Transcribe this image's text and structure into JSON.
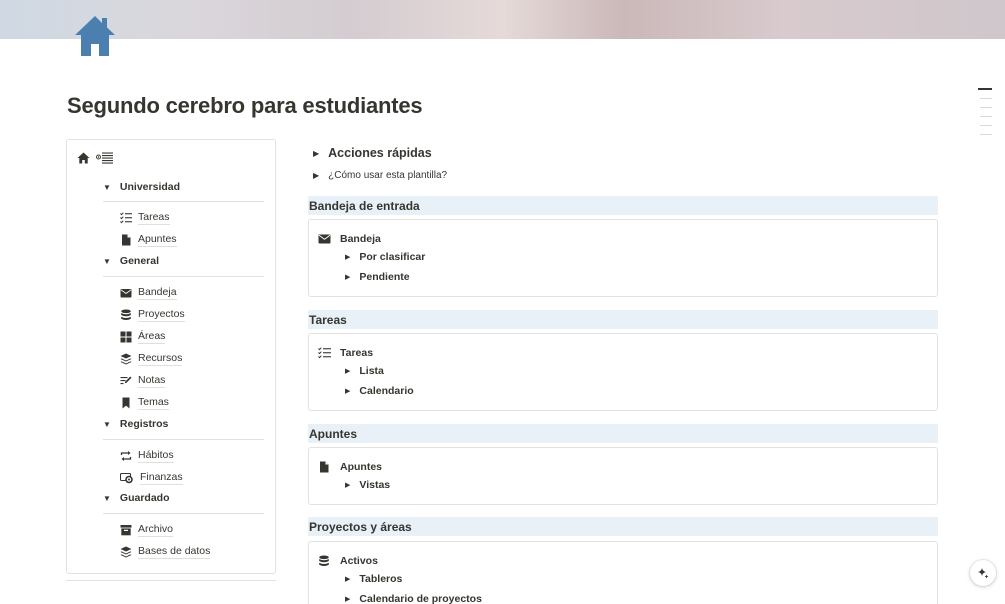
{
  "page": {
    "title": "Segundo cerebro para estudiantes",
    "icon": "house-icon",
    "cover_colors": [
      "#cfd9e3",
      "#d4ccd1",
      "#cbb8b9"
    ],
    "accent": "#4a7fb0"
  },
  "sidebar": {
    "groups": [
      {
        "label": "Universidad",
        "items": [
          {
            "label": "Tareas",
            "icon": "checklist-icon"
          },
          {
            "label": "Apuntes",
            "icon": "document-icon"
          }
        ]
      },
      {
        "label": "General",
        "items": [
          {
            "label": "Bandeja",
            "icon": "envelope-icon"
          },
          {
            "label": "Proyectos",
            "icon": "database-icon"
          },
          {
            "label": "Áreas",
            "icon": "grid-icon"
          },
          {
            "label": "Recursos",
            "icon": "layers-icon"
          },
          {
            "label": "Notas",
            "icon": "pencil-lines-icon"
          },
          {
            "label": "Temas",
            "icon": "bookmark-icon"
          }
        ]
      },
      {
        "label": "Registros",
        "items": [
          {
            "label": "Hábitos",
            "icon": "repeat-icon"
          },
          {
            "label": "Finanzas",
            "icon": "money-icon"
          }
        ]
      },
      {
        "label": "Guardado",
        "items": [
          {
            "label": "Archivo",
            "icon": "archive-icon"
          },
          {
            "label": "Bases de datos",
            "icon": "layers-icon"
          }
        ]
      }
    ]
  },
  "main": {
    "quick_actions": "Acciones rápidas",
    "how_to": "¿Cómo usar esta plantilla?",
    "sections": [
      {
        "heading": "Bandeja de entrada",
        "card_title": "Bandeja",
        "icon": "envelope-icon",
        "toggles": [
          "Por clasificar",
          "Pendiente"
        ]
      },
      {
        "heading": "Tareas",
        "card_title": "Tareas",
        "icon": "checklist-icon",
        "toggles": [
          "Lista",
          "Calendario"
        ]
      },
      {
        "heading": "Apuntes",
        "card_title": "Apuntes",
        "icon": "document-icon",
        "toggles": [
          "Vistas"
        ]
      },
      {
        "heading": "Proyectos y áreas",
        "card_title": "Activos",
        "icon": "database-icon",
        "toggles": [
          "Tableros",
          "Calendario de proyectos"
        ]
      }
    ]
  },
  "glyphs": {
    "collapsed": "▶",
    "expanded": "▼"
  }
}
